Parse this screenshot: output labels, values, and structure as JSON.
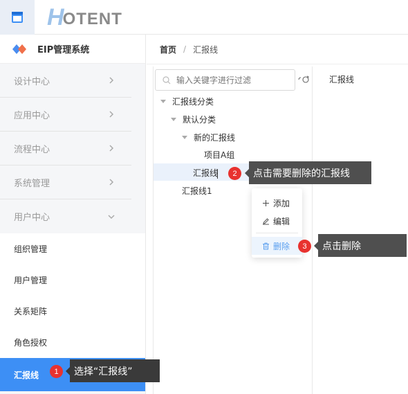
{
  "header": {
    "logo_h": "H",
    "logo_rest": "OTENT"
  },
  "system": {
    "title": "EIP管理系统"
  },
  "sidebar": {
    "groups": [
      {
        "label": "设计中心"
      },
      {
        "label": "应用中心"
      },
      {
        "label": "流程中心"
      },
      {
        "label": "系统管理"
      },
      {
        "label": "用户中心"
      }
    ],
    "subitems": [
      {
        "label": "组织管理"
      },
      {
        "label": "用户管理"
      },
      {
        "label": "关系矩阵"
      },
      {
        "label": "角色授权"
      },
      {
        "label": "汇报线"
      }
    ]
  },
  "breadcrumb": {
    "home": "首页",
    "sep": "/",
    "current": "汇报线"
  },
  "tree": {
    "search_placeholder": "输入关键字进行过滤",
    "nodes": [
      {
        "label": "汇报线分类"
      },
      {
        "label": "默认分类"
      },
      {
        "label": "新的汇报线"
      },
      {
        "label": "项目A组"
      },
      {
        "label": "汇报线"
      },
      {
        "label": "汇报线1"
      }
    ]
  },
  "right_panel": {
    "title": "汇报线"
  },
  "context_menu": {
    "add": "添加",
    "edit": "编辑",
    "delete": "删除"
  },
  "callouts": [
    {
      "num": "1",
      "text": "选择“汇报线”"
    },
    {
      "num": "2",
      "text": "点击需要删除的汇报线"
    },
    {
      "num": "3",
      "text": "点击删除"
    }
  ],
  "colors": {
    "accent": "#3d8ff5",
    "badge": "#e8322f",
    "tooltip": "#4f4f4f"
  }
}
